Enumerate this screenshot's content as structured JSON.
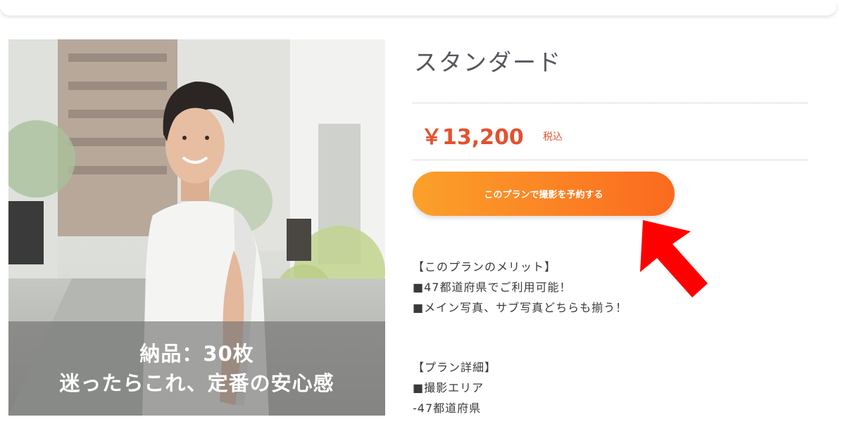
{
  "plan": {
    "title": "スタンダード",
    "price": "￥13,200",
    "tax_label": "税込",
    "book_button_label": "このプランで撮影を予約する"
  },
  "photo": {
    "caption_line1": "納品：30枚",
    "caption_line2": "迷ったらこれ、定番の安心感"
  },
  "merits": {
    "heading": "【このプランのメリット】",
    "items": [
      "■47都道府県でご利用可能！",
      "■メイン写真、サブ写真どちらも揃う！"
    ]
  },
  "details": {
    "heading": "【プラン詳細】",
    "area_label": "■撮影エリア",
    "area_value": "-47都道府県"
  },
  "colors": {
    "price": "#e4512e",
    "button_start": "#fba12a",
    "button_end": "#fb6a1f",
    "annotation_arrow": "#ff0000"
  },
  "icons": {
    "annotation": "red-arrow-icon"
  }
}
